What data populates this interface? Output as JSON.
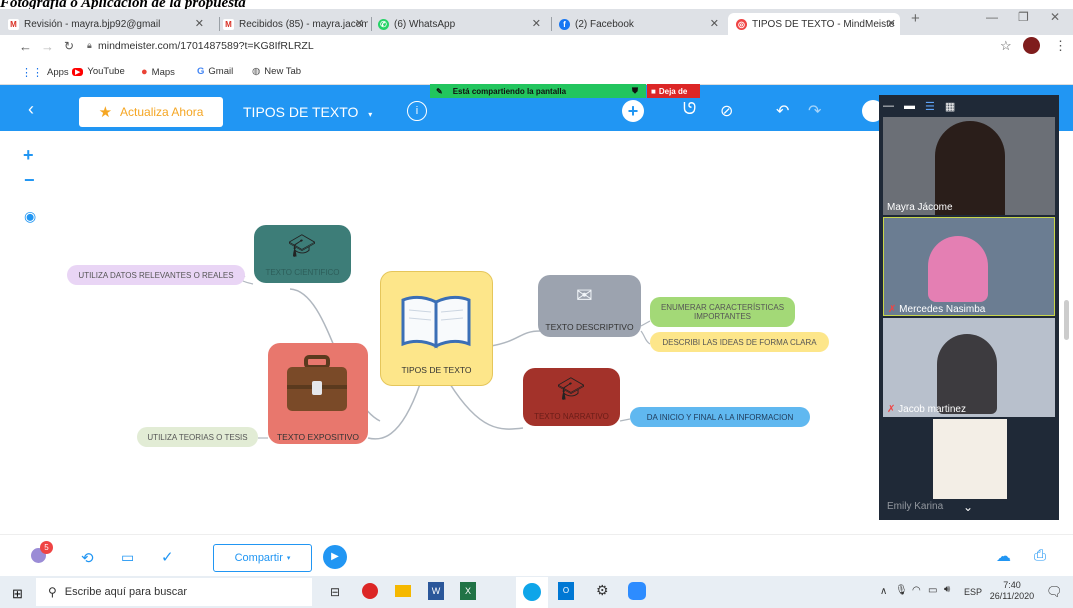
{
  "caption": "Fotografía o Aplicación de la propuesta",
  "tabs": [
    {
      "label": "Revisión - mayra.bjp92@gmail",
      "icon": "gmail-icon",
      "active": false
    },
    {
      "label": "Recibidos (85) - mayra.jacome",
      "icon": "gmail-icon",
      "active": false
    },
    {
      "label": "(6) WhatsApp",
      "icon": "whatsapp-icon",
      "active": false
    },
    {
      "label": "(2) Facebook",
      "icon": "facebook-icon",
      "active": false
    },
    {
      "label": "TIPOS DE TEXTO - MindMeiste",
      "icon": "mindmeister-icon",
      "active": true
    }
  ],
  "address": {
    "url": "mindmeister.com/1701487589?t=KG8IfRLRZL"
  },
  "bookmarks": [
    {
      "label": "Apps",
      "icon": "apps-grid-icon"
    },
    {
      "label": "YouTube",
      "icon": "youtube-icon"
    },
    {
      "label": "Maps",
      "icon": "maps-pin-icon"
    },
    {
      "label": "Gmail",
      "icon": "google-icon"
    },
    {
      "label": "New Tab",
      "icon": "globe-icon"
    }
  ],
  "share_notice": {
    "text": "Está compartiendo la pantalla",
    "stop": "Deja de"
  },
  "toolbar": {
    "upgrade": "Actualiza Ahora",
    "map_title": "TIPOS DE TEXTO"
  },
  "mindmap": {
    "center": "TIPOS DE TEXTO",
    "nodes": {
      "cientifico": "TEXTO CIENTIFICO",
      "descriptivo": "TEXTO DESCRIPTIVO",
      "narrativo": "TEXTO NARRATIVO",
      "expositivo": "TEXTO EXPOSITIVO"
    },
    "leaves": {
      "cientifico": "UTILIZA DATOS RELEVANTES O REALES",
      "descriptivo_1": "ENUMERAR CARACTERÍSTICAS IMPORTANTES",
      "descriptivo_2": "DESCRIBI LAS IDEAS DE FORMA CLARA",
      "narrativo": "DA INICIO Y FINAL A LA INFORMACION",
      "expositivo": "UTILIZA TEORIAS O TESIS"
    }
  },
  "bottom": {
    "share": "Compartir",
    "notif_count": "5"
  },
  "video": {
    "participants": [
      "Mayra Jácome",
      "Mercedes Nasimba",
      "Jacob martinez",
      "Emily Karina"
    ]
  },
  "taskbar": {
    "search": "Escribe aquí para buscar",
    "lang": "ESP",
    "time": "7:40",
    "date": "26/11/2020"
  },
  "colors": {
    "accent": "#2196f3",
    "cientifico": "#3d7d78",
    "descriptivo": "#9ca3af",
    "narrativo": "#a3322a",
    "expositivo": "#e8776d",
    "center": "#fde68a"
  }
}
